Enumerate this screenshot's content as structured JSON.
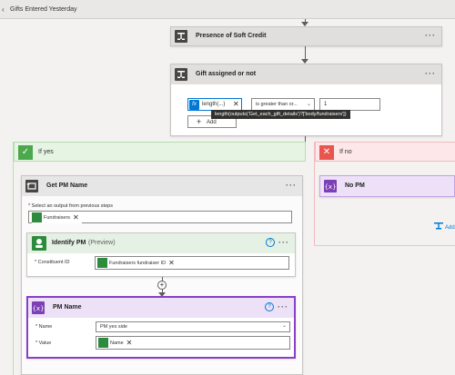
{
  "topbar": {
    "title": "Gifts Entered Yesterday"
  },
  "steps": {
    "soft_credit": {
      "title": "Presence of Soft Credit"
    },
    "gift_assigned": {
      "title": "Gift assigned or not",
      "expr_chip": "length(...)",
      "operator": "is greater than or...",
      "value": "1",
      "tooltip": "length(outputs('Get_each_gift_details')?['body/fundraisers'])",
      "add_label": "Add"
    }
  },
  "if_yes": {
    "title": "If yes",
    "get_pm": {
      "title": "Get PM Name",
      "select_label": "* Select an output from previous steps",
      "select_tag": "Fundraisers"
    },
    "identify_pm": {
      "title": "Identify PM",
      "badge": "(Preview)",
      "field_label": "* Constituent ID",
      "field_tag": "Fundraisers fundraiser ID"
    },
    "pm_name": {
      "title": "PM Name",
      "name_label": "* Name",
      "name_value": "PM yes side",
      "value_label": "* Value",
      "value_tag": "Name"
    }
  },
  "if_no": {
    "title": "If no",
    "no_pm": {
      "title": "No PM"
    },
    "add_label": "Add"
  }
}
